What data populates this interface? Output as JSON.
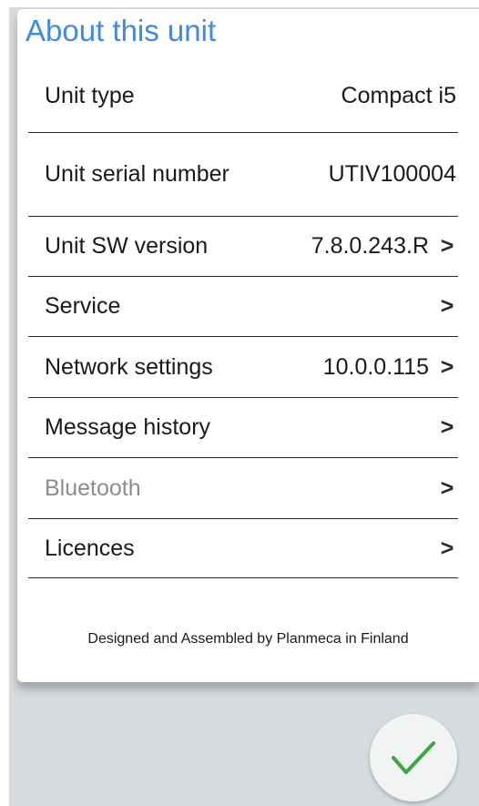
{
  "title": "About this unit",
  "rows": [
    {
      "label": "Unit type",
      "value": "Compact i5"
    },
    {
      "label": "Unit serial number",
      "value": "UTIV100004"
    },
    {
      "label": "Unit SW version",
      "value": "7.8.0.243.R",
      "chevron": ">"
    },
    {
      "label": "Service",
      "value": "",
      "chevron": ">"
    },
    {
      "label": "Network settings",
      "value": "10.0.0.115",
      "chevron": ">"
    },
    {
      "label": "Message history",
      "value": "",
      "chevron": ">"
    },
    {
      "label": "Bluetooth",
      "value": "",
      "chevron": ">",
      "disabled": true
    },
    {
      "label": "Licences",
      "value": "",
      "chevron": ">"
    }
  ],
  "footer": "Designed and Assembled by Planmeca in Finland",
  "ok_button": {
    "icon": "checkmark-icon",
    "color": "#3aa843"
  },
  "colors": {
    "title": "#3f8ae6",
    "disabled_text": "#8d8d8d",
    "background": "#d6dcde"
  }
}
